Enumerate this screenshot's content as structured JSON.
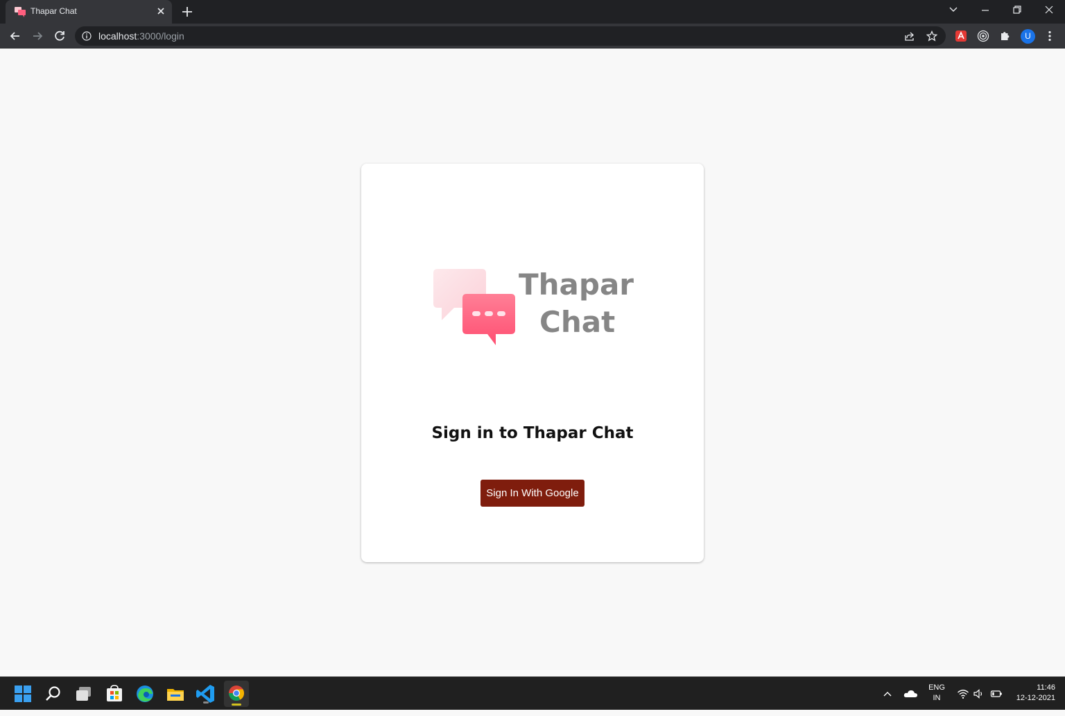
{
  "browser": {
    "tab": {
      "title": "Thapar Chat",
      "favicon": "chat-bubbles-icon",
      "close_icon": "close-icon"
    },
    "new_tab_icon": "plus-icon",
    "window_controls": [
      "tab-search-icon",
      "minimize-icon",
      "restore-icon",
      "close-icon"
    ],
    "omnibox": {
      "host": "localhost",
      "path": ":3000/login",
      "info_icon": "info-icon",
      "share_icon": "share-icon",
      "star_icon": "star-icon"
    },
    "extensions": [
      "extension-red-icon",
      "extension-target-icon",
      "puzzle-icon"
    ],
    "profile_initial": "U",
    "profile_color": "#1a73e8"
  },
  "logo": {
    "line1": "Thapar",
    "line2": "Chat",
    "text_color": "#868686",
    "bubble_back_color": "#fde3e8",
    "bubble_front_color": "#ff5f7e"
  },
  "login": {
    "heading": "Sign in to Thapar Chat",
    "google_button": "Sign In With Google",
    "button_color": "#7f1d0d"
  },
  "taskbar": {
    "apps": [
      "windows-start-icon",
      "search-icon",
      "task-view-icon",
      "microsoft-store-icon",
      "edge-icon",
      "file-explorer-icon",
      "vscode-icon",
      "chrome-icon"
    ],
    "active_app": "chrome-icon",
    "tray": {
      "lang_line1": "ENG",
      "lang_line2": "IN",
      "time": "11:46",
      "date": "12-12-2021"
    }
  }
}
